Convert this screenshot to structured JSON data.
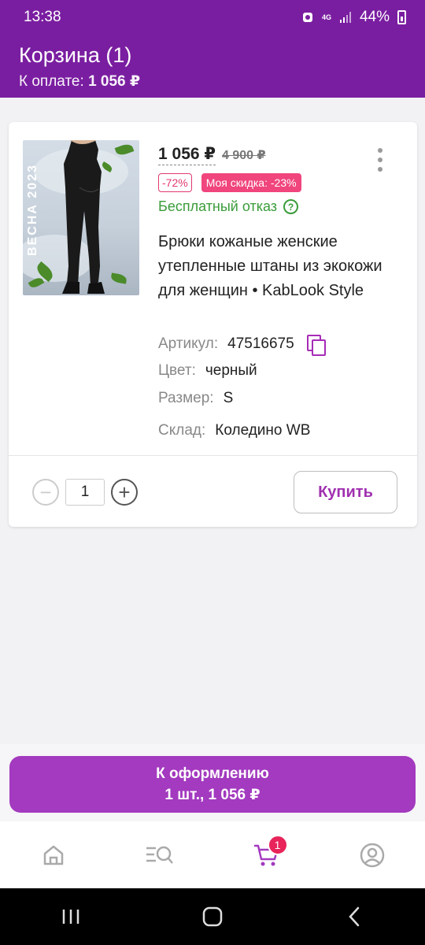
{
  "status_bar": {
    "time": "13:38",
    "battery": "44%",
    "network": "4G"
  },
  "header": {
    "title": "Корзина (1)",
    "subtitle_label": "К оплате:",
    "subtitle_value": "1 056 ₽"
  },
  "product": {
    "price": "1 056 ₽",
    "old_price": "4 900 ₽",
    "discount": "-72%",
    "my_discount": "Моя скидка: -23%",
    "free_return": "Бесплатный отказ",
    "title": "Брюки кожаные женские утепленные штаны из экокожи для женщин • KabLook Style",
    "image_text": "ВЕСНА 2023",
    "attrs": {
      "article_label": "Артикул:",
      "article_value": "47516675",
      "color_label": "Цвет:",
      "color_value": "черный",
      "size_label": "Размер:",
      "size_value": "S",
      "warehouse_label": "Склад:",
      "warehouse_value": "Коледино WB"
    },
    "quantity": "1",
    "buy_label": "Купить"
  },
  "checkout": {
    "line1": "К оформлению",
    "line2": "1 шт., 1 056 ₽"
  },
  "nav": {
    "cart_count": "1"
  },
  "colors": {
    "brand": "#7a1ea1",
    "accent": "#a33abf",
    "badge": "#e8245a",
    "green": "#3a9c3a"
  }
}
